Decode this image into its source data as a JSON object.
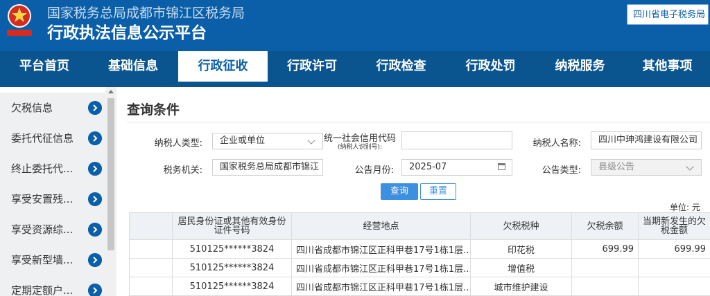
{
  "header": {
    "org_name": "国家税务总局成都市锦江区税务局",
    "title": "行政执法信息公示平台",
    "etax_link": "四川省电子税务局"
  },
  "nav": {
    "items": [
      {
        "label": "平台首页"
      },
      {
        "label": "基础信息"
      },
      {
        "label": "行政征收",
        "active": true
      },
      {
        "label": "行政许可"
      },
      {
        "label": "行政检查"
      },
      {
        "label": "行政处罚"
      },
      {
        "label": "纳税服务"
      },
      {
        "label": "其他事项"
      }
    ]
  },
  "sidebar": {
    "items": [
      {
        "label": "欠税信息"
      },
      {
        "label": "委托代征信息"
      },
      {
        "label": "终止委托代..."
      },
      {
        "label": "享受安置残..."
      },
      {
        "label": "享受资源综..."
      },
      {
        "label": "享受新型墙..."
      },
      {
        "label": "定期定额户..."
      }
    ]
  },
  "query": {
    "title": "查询条件",
    "taxpayer_type_label": "纳税人类型:",
    "taxpayer_type_value": "企业或单位",
    "credit_code_label": "统一社会信用代码",
    "credit_code_sublabel": "(纳税人识别号):",
    "credit_code_value": "",
    "taxpayer_name_label": "纳税人名称:",
    "taxpayer_name_value": "四川中珅鸿建设有限公司",
    "tax_authority_label": "税务机关:",
    "tax_authority_value": "国家税务总局成都市锦江",
    "month_label": "公告月份:",
    "month_value": "2025-07",
    "notice_type_label": "公告类型:",
    "notice_type_value": "县级公告",
    "search_button": "查询",
    "reset_button": "重置"
  },
  "results": {
    "unit": "单位: 元",
    "columns": [
      "",
      "居民身份证或其他有效身份证件号码",
      "经营地点",
      "欠税税种",
      "欠税余额",
      "当期新发生的欠税金额"
    ],
    "rows": [
      [
        "",
        "510125******3824",
        "四川省成都市锦江区正科甲巷17号1栋1层...",
        "印花税",
        "699.99",
        "699.99"
      ],
      [
        "",
        "510125******3824",
        "四川省成都市锦江区正科甲巷17号1栋1层...",
        "增值税",
        "",
        ""
      ],
      [
        "",
        "510125******3824",
        "四川省成都市锦江区正科甲巷17号1栋1层...",
        "城市维护建设",
        "",
        ""
      ]
    ]
  },
  "colors": {
    "header_blue": "#0b5fa8",
    "nav_blue": "#0a548f",
    "button_blue": "#3d8fe0",
    "emblem_red": "#d62b1f"
  },
  "icons": {
    "emblem": "tax-emblem-icon",
    "sidebar_arrow": "chevron-right-circle-icon",
    "select": "chevron-down-icon",
    "date": "calendar-icon"
  }
}
